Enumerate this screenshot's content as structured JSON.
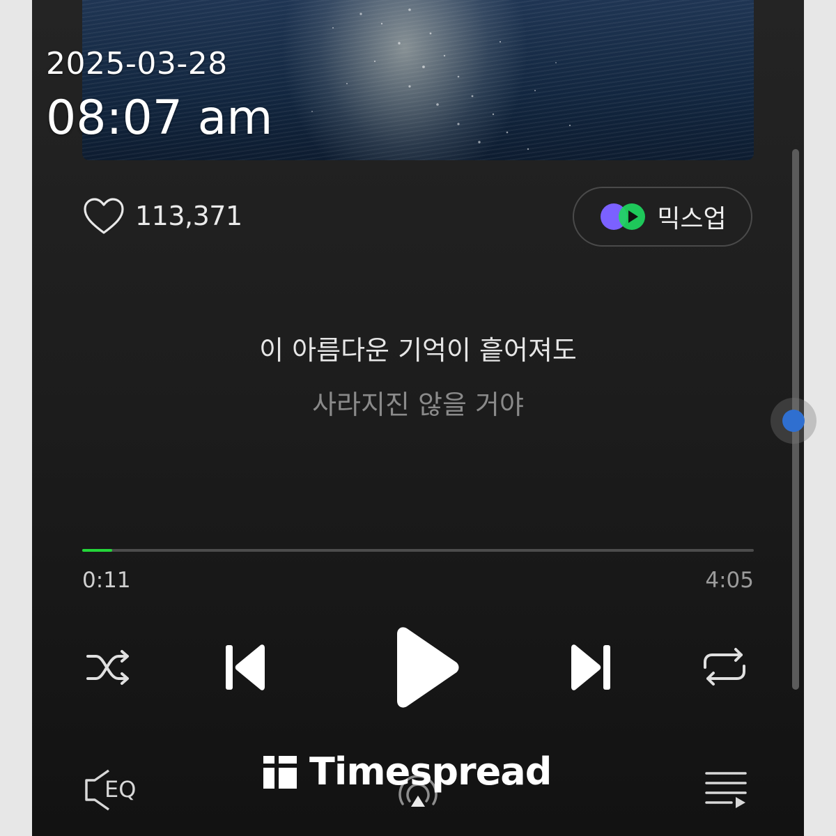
{
  "overlay": {
    "date": "2025-03-28",
    "time": "08:07 am",
    "watermark": "Timespread"
  },
  "player": {
    "like_count": "113,371",
    "mixup_label": "믹스업",
    "lyrics": {
      "current": "이 아름다운 기억이 흩어져도",
      "next": "사라지진 않을 거야"
    },
    "progress": {
      "elapsed": "0:11",
      "total": "4:05",
      "fraction": 0.045
    }
  },
  "bottom_bar": {
    "eq_label": "EQ"
  },
  "icons": {
    "like": "heart-icon",
    "mixup": "mixup-icon",
    "shuffle": "shuffle-icon",
    "previous": "skip-previous-icon",
    "play": "play-icon",
    "next": "skip-next-icon",
    "repeat": "repeat-icon",
    "eq": "equalizer-icon",
    "cast": "cast-icon",
    "playlist": "playlist-icon"
  },
  "colors": {
    "progress_fill": "#24d63a",
    "mixup_purple": "#7b61ff",
    "mixup_green": "#1ed760"
  }
}
